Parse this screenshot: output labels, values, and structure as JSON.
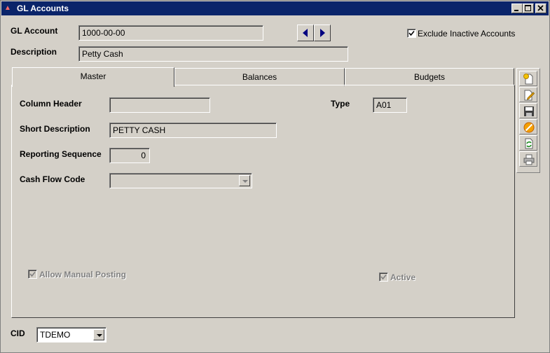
{
  "window": {
    "title": "GL Accounts"
  },
  "header": {
    "gl_account_label": "GL Account",
    "gl_account_value": "1000-00-00",
    "description_label": "Description",
    "description_value": "Petty Cash",
    "exclude_inactive_label": "Exclude Inactive Accounts",
    "exclude_inactive_checked": true
  },
  "tabs": [
    {
      "label": "Master",
      "active": true
    },
    {
      "label": "Balances",
      "active": false
    },
    {
      "label": "Budgets",
      "active": false
    }
  ],
  "master": {
    "column_header_label": "Column Header",
    "column_header_value": "",
    "type_label": "Type",
    "type_value": "A01",
    "short_description_label": "Short Description",
    "short_description_value": "PETTY CASH",
    "reporting_sequence_label": "Reporting Sequence",
    "reporting_sequence_value": "0",
    "cash_flow_code_label": "Cash Flow Code",
    "cash_flow_code_value": "",
    "allow_manual_posting_label": "Allow Manual Posting",
    "allow_manual_posting_checked": true,
    "active_label": "Active",
    "active_checked": true
  },
  "footer": {
    "cid_label": "CID",
    "cid_value": "TDEMO"
  },
  "colors": {
    "titlebar": "#0a246a",
    "face": "#d4d0c8",
    "nav_arrow": "#000080"
  },
  "toolbar_icons": [
    "new-record-icon",
    "edit-record-icon",
    "save-icon",
    "cancel-icon",
    "refresh-icon",
    "print-icon"
  ]
}
